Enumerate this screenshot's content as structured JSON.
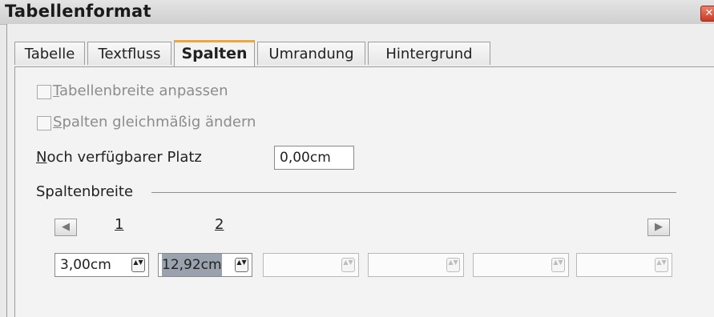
{
  "window": {
    "title": "Tabellenformat",
    "close_glyph": "✕"
  },
  "tabs": [
    {
      "label": "Tabelle",
      "active": false
    },
    {
      "label": "Textfluss",
      "active": false
    },
    {
      "label": "Spalten",
      "active": true
    },
    {
      "label": "Umrandung",
      "active": false
    },
    {
      "label": "Hintergrund",
      "active": false
    }
  ],
  "options": {
    "adapt_table_width": {
      "accel": "T",
      "rest": "abellenbreite anpassen",
      "checked": false,
      "enabled": false
    },
    "even_columns": {
      "accel": "S",
      "rest": "palten gleichmäßig ändern",
      "checked": false,
      "enabled": false
    }
  },
  "remaining_space": {
    "accel": "N",
    "rest": "och verfügbarer Platz",
    "value": "0,00cm"
  },
  "column_width": {
    "section_label": "Spaltenbreite",
    "prev_icon": "arrow-left-icon",
    "next_icon": "arrow-right-icon",
    "prev_glyph": "◀",
    "next_glyph": "▶",
    "column_numbers": [
      "1",
      "2"
    ],
    "fields": [
      {
        "value": "3,00cm",
        "enabled": true,
        "selected": false
      },
      {
        "value": "12,92cm",
        "enabled": true,
        "selected": true
      },
      {
        "value": "",
        "enabled": false,
        "selected": false
      },
      {
        "value": "",
        "enabled": false,
        "selected": false
      },
      {
        "value": "",
        "enabled": false,
        "selected": false
      },
      {
        "value": "",
        "enabled": false,
        "selected": false
      }
    ],
    "spin_glyph": "▲▼"
  },
  "colors": {
    "active_tab_accent": "#f0a640",
    "selection": "#9aa3ad"
  }
}
